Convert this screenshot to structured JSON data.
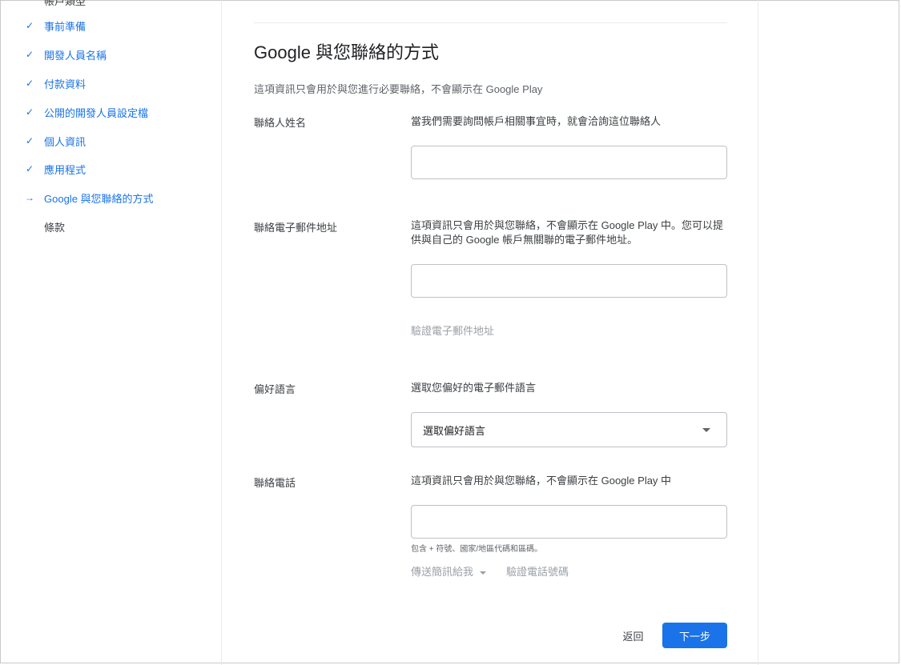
{
  "sidebar": {
    "cut_top_label": "帳戶類型",
    "steps": [
      {
        "label": "事前準備",
        "status": "done",
        "icon": "check-icon"
      },
      {
        "label": "開發人員名稱",
        "status": "done",
        "icon": "check-icon"
      },
      {
        "label": "付款資料",
        "status": "done",
        "icon": "check-icon"
      },
      {
        "label": "公開的開發人員設定檔",
        "status": "done",
        "icon": "check-icon"
      },
      {
        "label": "個人資訊",
        "status": "done",
        "icon": "check-icon"
      },
      {
        "label": "應用程式",
        "status": "done",
        "icon": "check-icon"
      },
      {
        "label": "Google 與您聯絡的方式",
        "status": "current",
        "icon": "arrow-right-icon"
      },
      {
        "label": "條款",
        "status": "todo",
        "icon": ""
      }
    ]
  },
  "main": {
    "title": "Google 與您聯絡的方式",
    "subtitle": "這項資訊只會用於與您進行必要聯絡，不會顯示在 Google Play",
    "contact_name": {
      "label": "聯絡人姓名",
      "description": "當我們需要詢問帳戶相關事宜時，就會洽詢這位聯絡人",
      "value": ""
    },
    "contact_email": {
      "label": "聯絡電子郵件地址",
      "description": "這項資訊只會用於與您聯絡，不會顯示在 Google Play 中。您可以提供與自己的 Google 帳戶無關聯的電子郵件地址。",
      "value": "",
      "verify_link": "驗證電子郵件地址"
    },
    "preferred_language": {
      "label": "偏好語言",
      "description": "選取您偏好的電子郵件語言",
      "selected": "選取偏好語言"
    },
    "contact_phone": {
      "label": "聯絡電話",
      "description": "這項資訊只會用於與您聯絡，不會顯示在 Google Play 中",
      "value": "",
      "hint": "包含 + 符號、國家/地區代碼和區碼。",
      "send_sms": "傳送簡訊給我",
      "verify_phone": "驗證電話號碼"
    },
    "buttons": {
      "back": "返回",
      "next": "下一步"
    }
  },
  "colors": {
    "accent": "#1a73e8",
    "disabled_text": "#9aa0a6",
    "border": "#bdc1c6"
  }
}
